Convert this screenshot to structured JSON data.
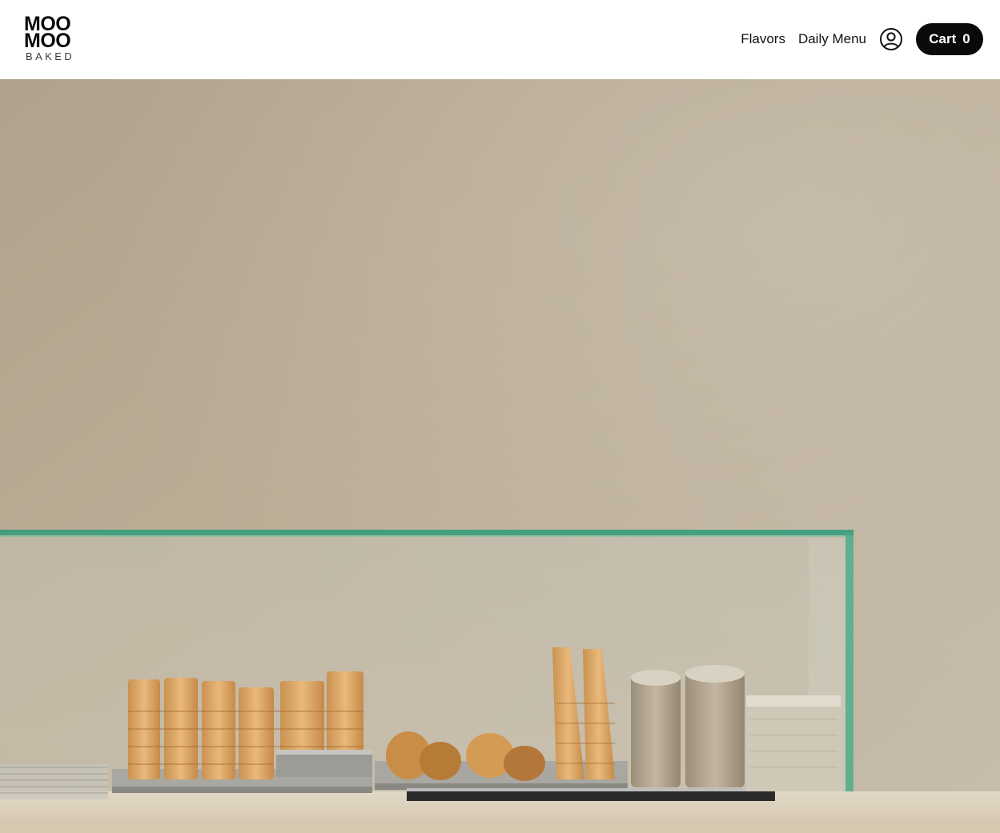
{
  "brand": {
    "line1": "MOO",
    "line2": "MOO",
    "sub": "BAKED"
  },
  "nav": {
    "items": [
      {
        "label": "Flavors"
      },
      {
        "label": "Daily Menu"
      }
    ],
    "account_icon": "user-circle-icon",
    "cart": {
      "label": "Cart",
      "count": "0"
    }
  },
  "hero": {
    "image": "ice-cream-counter-photo"
  },
  "colors": {
    "header_bg": "#ffffff",
    "cart_bg": "#0a0a0a",
    "cart_text": "#ffffff",
    "wall": "#bcae97",
    "glass_edge": "#2f9a78",
    "counter": "#ddd0bb"
  }
}
